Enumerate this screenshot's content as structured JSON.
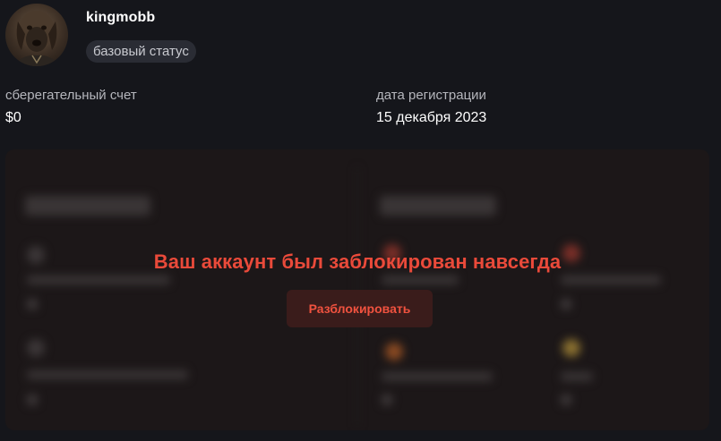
{
  "profile": {
    "username": "kingmobb",
    "status_badge": "базовый статус"
  },
  "stats": {
    "savings_label": "сберегательный счет",
    "savings_value": "$0",
    "registration_label": "дата регистрации",
    "registration_value": "15 декабря 2023"
  },
  "lock_overlay": {
    "message": "Ваш аккаунт был заблокирован навсегда",
    "unlock_button": "Разблокировать"
  },
  "colors": {
    "background": "#15161b",
    "accent_red": "#ea4a3a",
    "unlock_button_bg": "#3a1c1b",
    "badge_bg": "#2a2c34"
  }
}
